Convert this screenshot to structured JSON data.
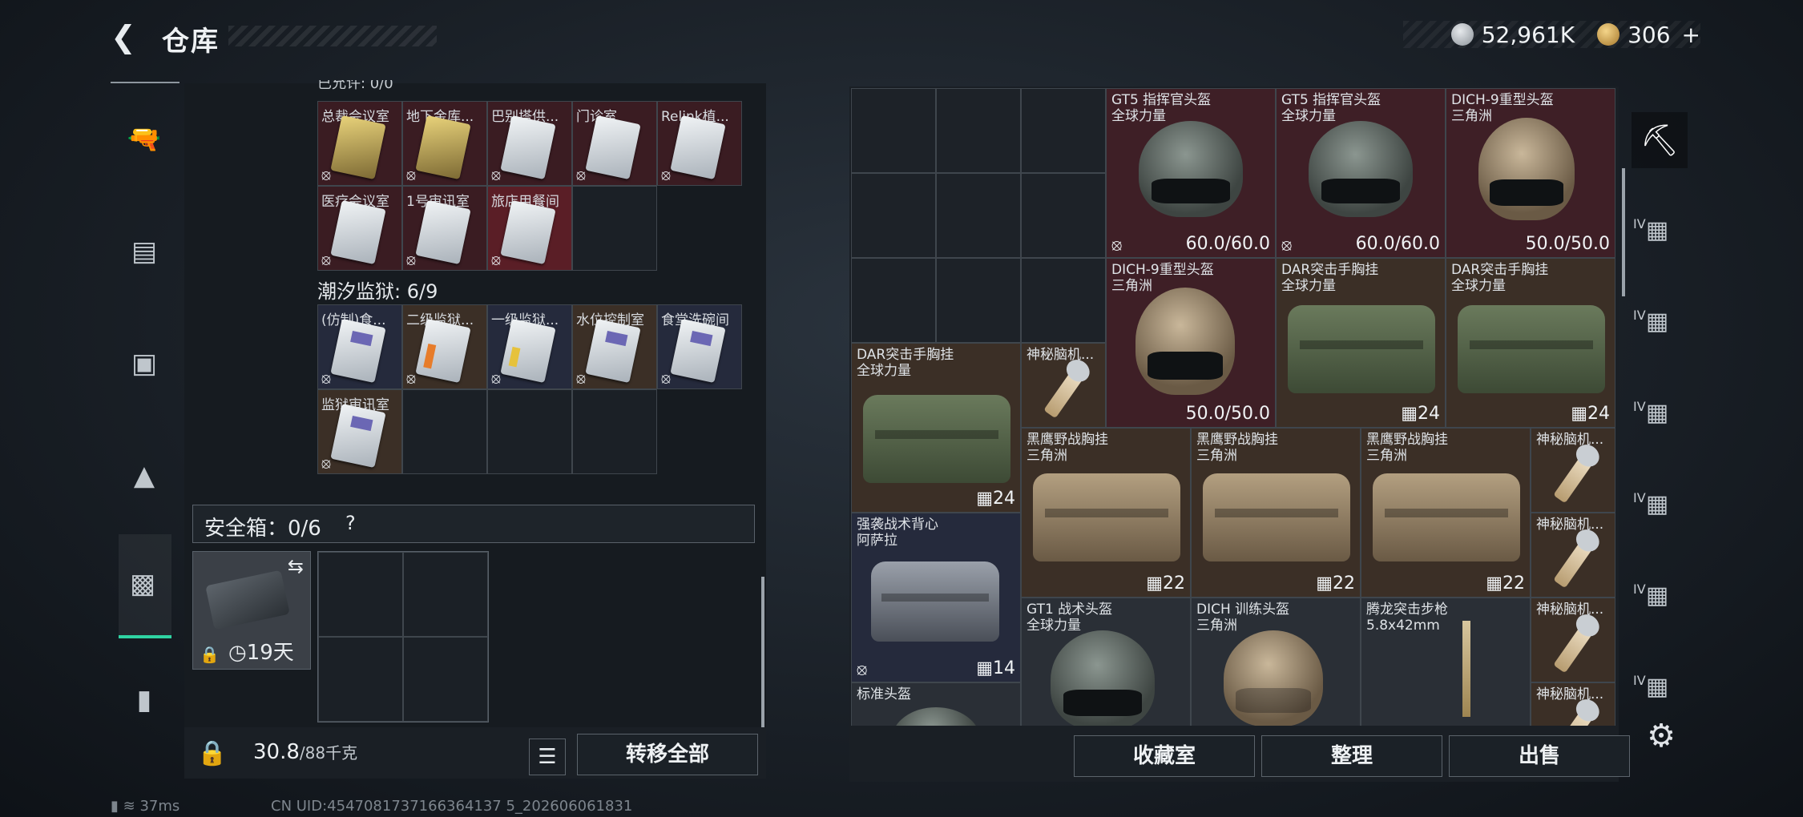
{
  "header": {
    "title": "仓库",
    "currency": [
      {
        "icon": "silver-coin-icon",
        "value": "52,961K"
      },
      {
        "icon": "gold-coin-icon",
        "value": "306",
        "plus": "+"
      }
    ]
  },
  "left_nav": [
    "pistol-icon",
    "armor-vest-icon",
    "backpack-icon",
    "helmet-icon",
    "safebox-icon",
    "briefcase-icon"
  ],
  "stash": {
    "section_top_partial": "已允许: 0/0",
    "group1": [
      {
        "label": "总裁会议室",
        "card": "gold"
      },
      {
        "label": "地下金库...",
        "card": "gold"
      },
      {
        "label": "巴别塔供...",
        "card": "white"
      },
      {
        "label": "门诊室",
        "card": "white"
      },
      {
        "label": "Relink植...",
        "card": "white"
      },
      {
        "label": "医疗会议室",
        "card": "white"
      },
      {
        "label": "1号审讯室",
        "card": "white"
      },
      {
        "label": "旅店用餐间",
        "card": "white"
      }
    ],
    "section2": "潮汐监狱: 6/9",
    "group2": [
      {
        "label": "(仿制)食...",
        "card": "purple"
      },
      {
        "label": "二级监狱...",
        "card": "orange"
      },
      {
        "label": "一级监狱...",
        "card": "yellow"
      },
      {
        "label": "水位控制室",
        "card": "purple"
      },
      {
        "label": "食堂洗碗间",
        "card": "purple"
      },
      {
        "label": "监狱审讯室",
        "card": "purple"
      }
    ],
    "safe_label": "安全箱：0/6",
    "safe_help": "?",
    "safe_days": "19天",
    "weight": "30.8",
    "weight_max": "/88千克",
    "transfer_all": "转移全部"
  },
  "storage": {
    "items": [
      {
        "name": "GT5 指挥官头盔",
        "sub": "全球力量",
        "value": "60.0/60.0"
      },
      {
        "name": "GT5 指挥官头盔",
        "sub": "全球力量",
        "value": "60.0/60.0"
      },
      {
        "name": "DICH-9重型头盔",
        "sub": "三角洲",
        "value": "50.0/50.0"
      },
      {
        "name": "DICH-9重型头盔",
        "sub": "三角洲",
        "value": "50.0/50.0"
      },
      {
        "name": "DAR突击手胸挂",
        "sub": "全球力量",
        "value": "24"
      },
      {
        "name": "DAR突击手胸挂",
        "sub": "全球力量",
        "value": "24"
      },
      {
        "name": "DAR突击手胸挂",
        "sub": "全球力量",
        "value": "24"
      },
      {
        "name": "神秘脑机...",
        "sub": "",
        "value": ""
      },
      {
        "name": "黑鹰野战胸挂",
        "sub": "三角洲",
        "value": "22"
      },
      {
        "name": "黑鹰野战胸挂",
        "sub": "三角洲",
        "value": "22"
      },
      {
        "name": "黑鹰野战胸挂",
        "sub": "三角洲",
        "value": "22"
      },
      {
        "name": "神秘脑机...",
        "sub": "",
        "value": ""
      },
      {
        "name": "强袭战术背心",
        "sub": "阿萨拉",
        "value": "14"
      },
      {
        "name": "神秘脑机...",
        "sub": "",
        "value": ""
      },
      {
        "name": "GT1 战术头盔",
        "sub": "全球力量",
        "value": ""
      },
      {
        "name": "DICH 训练头盔",
        "sub": "三角洲",
        "value": ""
      },
      {
        "name": "腾龙突击步枪",
        "sub": "5.8x42mm",
        "value": ""
      },
      {
        "name": "神秘脑机...",
        "sub": "",
        "value": ""
      },
      {
        "name": "神秘脑机...",
        "sub": "",
        "value": ""
      },
      {
        "name": "标准头盔",
        "sub": "",
        "value": ""
      }
    ],
    "buttons": {
      "collection": "收藏室",
      "sort": "整理",
      "sell": "出售"
    }
  },
  "right_nav": [
    {
      "icon": "helmet-storage-icon",
      "tier": ""
    },
    {
      "icon": "storage-tab-2-icon",
      "tier": "IV"
    },
    {
      "icon": "storage-tab-3-icon",
      "tier": "IV"
    },
    {
      "icon": "storage-tab-4-icon",
      "tier": "IV"
    },
    {
      "icon": "storage-tab-5-icon",
      "tier": "IV"
    },
    {
      "icon": "storage-tab-6-icon",
      "tier": "IV"
    },
    {
      "icon": "storage-tab-7-icon",
      "tier": "IV"
    }
  ],
  "status": {
    "ping": "37ms",
    "uid": "CN UID:4547081737166364137 5_202606061831"
  }
}
